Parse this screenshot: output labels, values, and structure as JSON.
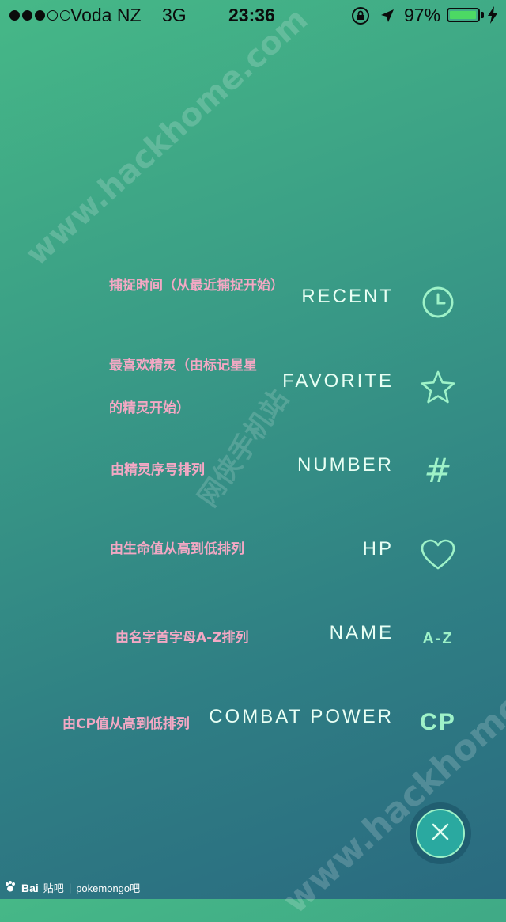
{
  "status_bar": {
    "signal_filled": 3,
    "signal_total": 5,
    "carrier": "Voda NZ",
    "network": "3G",
    "time": "23:36",
    "battery_percent": "97%",
    "battery_level": 0.97,
    "battery_color": "#4cd964"
  },
  "watermark": {
    "domain": "www.hackhome.com",
    "site_name": "网侠手机站"
  },
  "sort_options": [
    {
      "key": "recent",
      "label": "RECENT",
      "icon": "clock-icon",
      "note": "捕捉时间（从最近捕捉开始）"
    },
    {
      "key": "favorite",
      "label": "FAVORITE",
      "icon": "star-icon",
      "note_line1": "最喜欢精灵（由标记星星",
      "note_line2": "的精灵开始）"
    },
    {
      "key": "number",
      "label": "NUMBER",
      "icon": "hash-icon",
      "icon_text": "#",
      "note": "由精灵序号排列"
    },
    {
      "key": "hp",
      "label": "HP",
      "icon": "heart-icon",
      "note": "由生命值从高到低排列"
    },
    {
      "key": "name",
      "label": "NAME",
      "icon": "az-icon",
      "icon_text": "A-Z",
      "note": "由名字首字母A-Z排列"
    },
    {
      "key": "cp",
      "label": "COMBAT POWER",
      "icon": "cp-icon",
      "icon_text": "CP",
      "note": "由CP值从高到低排列"
    }
  ],
  "footer": {
    "baidu": "Bai",
    "tieba": "贴吧",
    "separator": "|",
    "forum": "pokemongo吧"
  },
  "colors": {
    "accent": "#9ef2c8",
    "label": "#e8fff4",
    "note": "#f3a8c4"
  }
}
